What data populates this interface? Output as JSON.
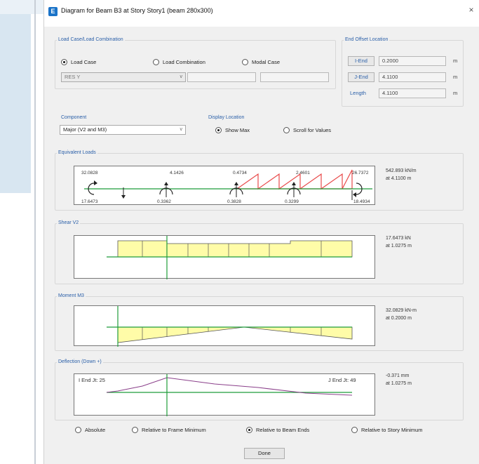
{
  "window": {
    "title": "Diagram for Beam B3 at Story Story1 (beam 280x300)",
    "close": "×",
    "app_icon": "E"
  },
  "load_case_group": {
    "title": "Load Case/Load Combination",
    "options": [
      "Load Case",
      "Load Combination",
      "Modal Case"
    ],
    "selected": "Load Case",
    "case_value": "RES Y",
    "dropdown_arrow": "v"
  },
  "end_offset": {
    "title": "End Offset Location",
    "i_end": {
      "button": "I-End",
      "value": "0.2000",
      "unit": "m"
    },
    "j_end": {
      "button": "J-End",
      "value": "4.1100",
      "unit": "m"
    },
    "length": {
      "label": "Length",
      "value": "4.1100",
      "unit": "m"
    }
  },
  "component": {
    "title": "Component",
    "value": "Major (V2 and M3)",
    "dropdown_arrow": "v"
  },
  "display_location": {
    "title": "Display Location",
    "options": [
      "Show Max",
      "Scroll for Values"
    ],
    "selected": "Show Max"
  },
  "equivalent_loads": {
    "title": "Equivalent Loads",
    "top_values": [
      "32.0828",
      "4.1426",
      "0.4734",
      "2.4601",
      "26.7372"
    ],
    "bottom_values": [
      "17.6473",
      "0.3362",
      "0.3828",
      "0.3299",
      "18.4934"
    ],
    "readout": [
      "542.893 kN/m",
      "at 4.1100 m"
    ]
  },
  "shear": {
    "title": "Shear V2",
    "readout": [
      "17.6473 kN",
      "at 1.0275 m"
    ]
  },
  "moment": {
    "title": "Moment M3",
    "readout": [
      "32.0829 kN-m",
      "at 0.2000 m"
    ]
  },
  "deflection": {
    "title": "Deflection (Down +)",
    "i_label": "I End Jt: 25",
    "j_label": "J End Jt: 49",
    "readout": [
      "-0.371 mm",
      "at 1.0275 m"
    ]
  },
  "relative_options": {
    "options": [
      "Absolute",
      "Relative to Frame Minimum",
      "Relative to Beam Ends",
      "Relative to Story Minimum"
    ],
    "selected": "Relative to Beam Ends"
  },
  "done_label": "Done",
  "colors": {
    "diagram_fill": "#fffca8",
    "diagram_edge": "#555555",
    "axis_green": "#1f9c3a",
    "load_red": "#e84a4a",
    "deflection": "#8a3f8a",
    "legend_blue": "#2a5fa8"
  }
}
